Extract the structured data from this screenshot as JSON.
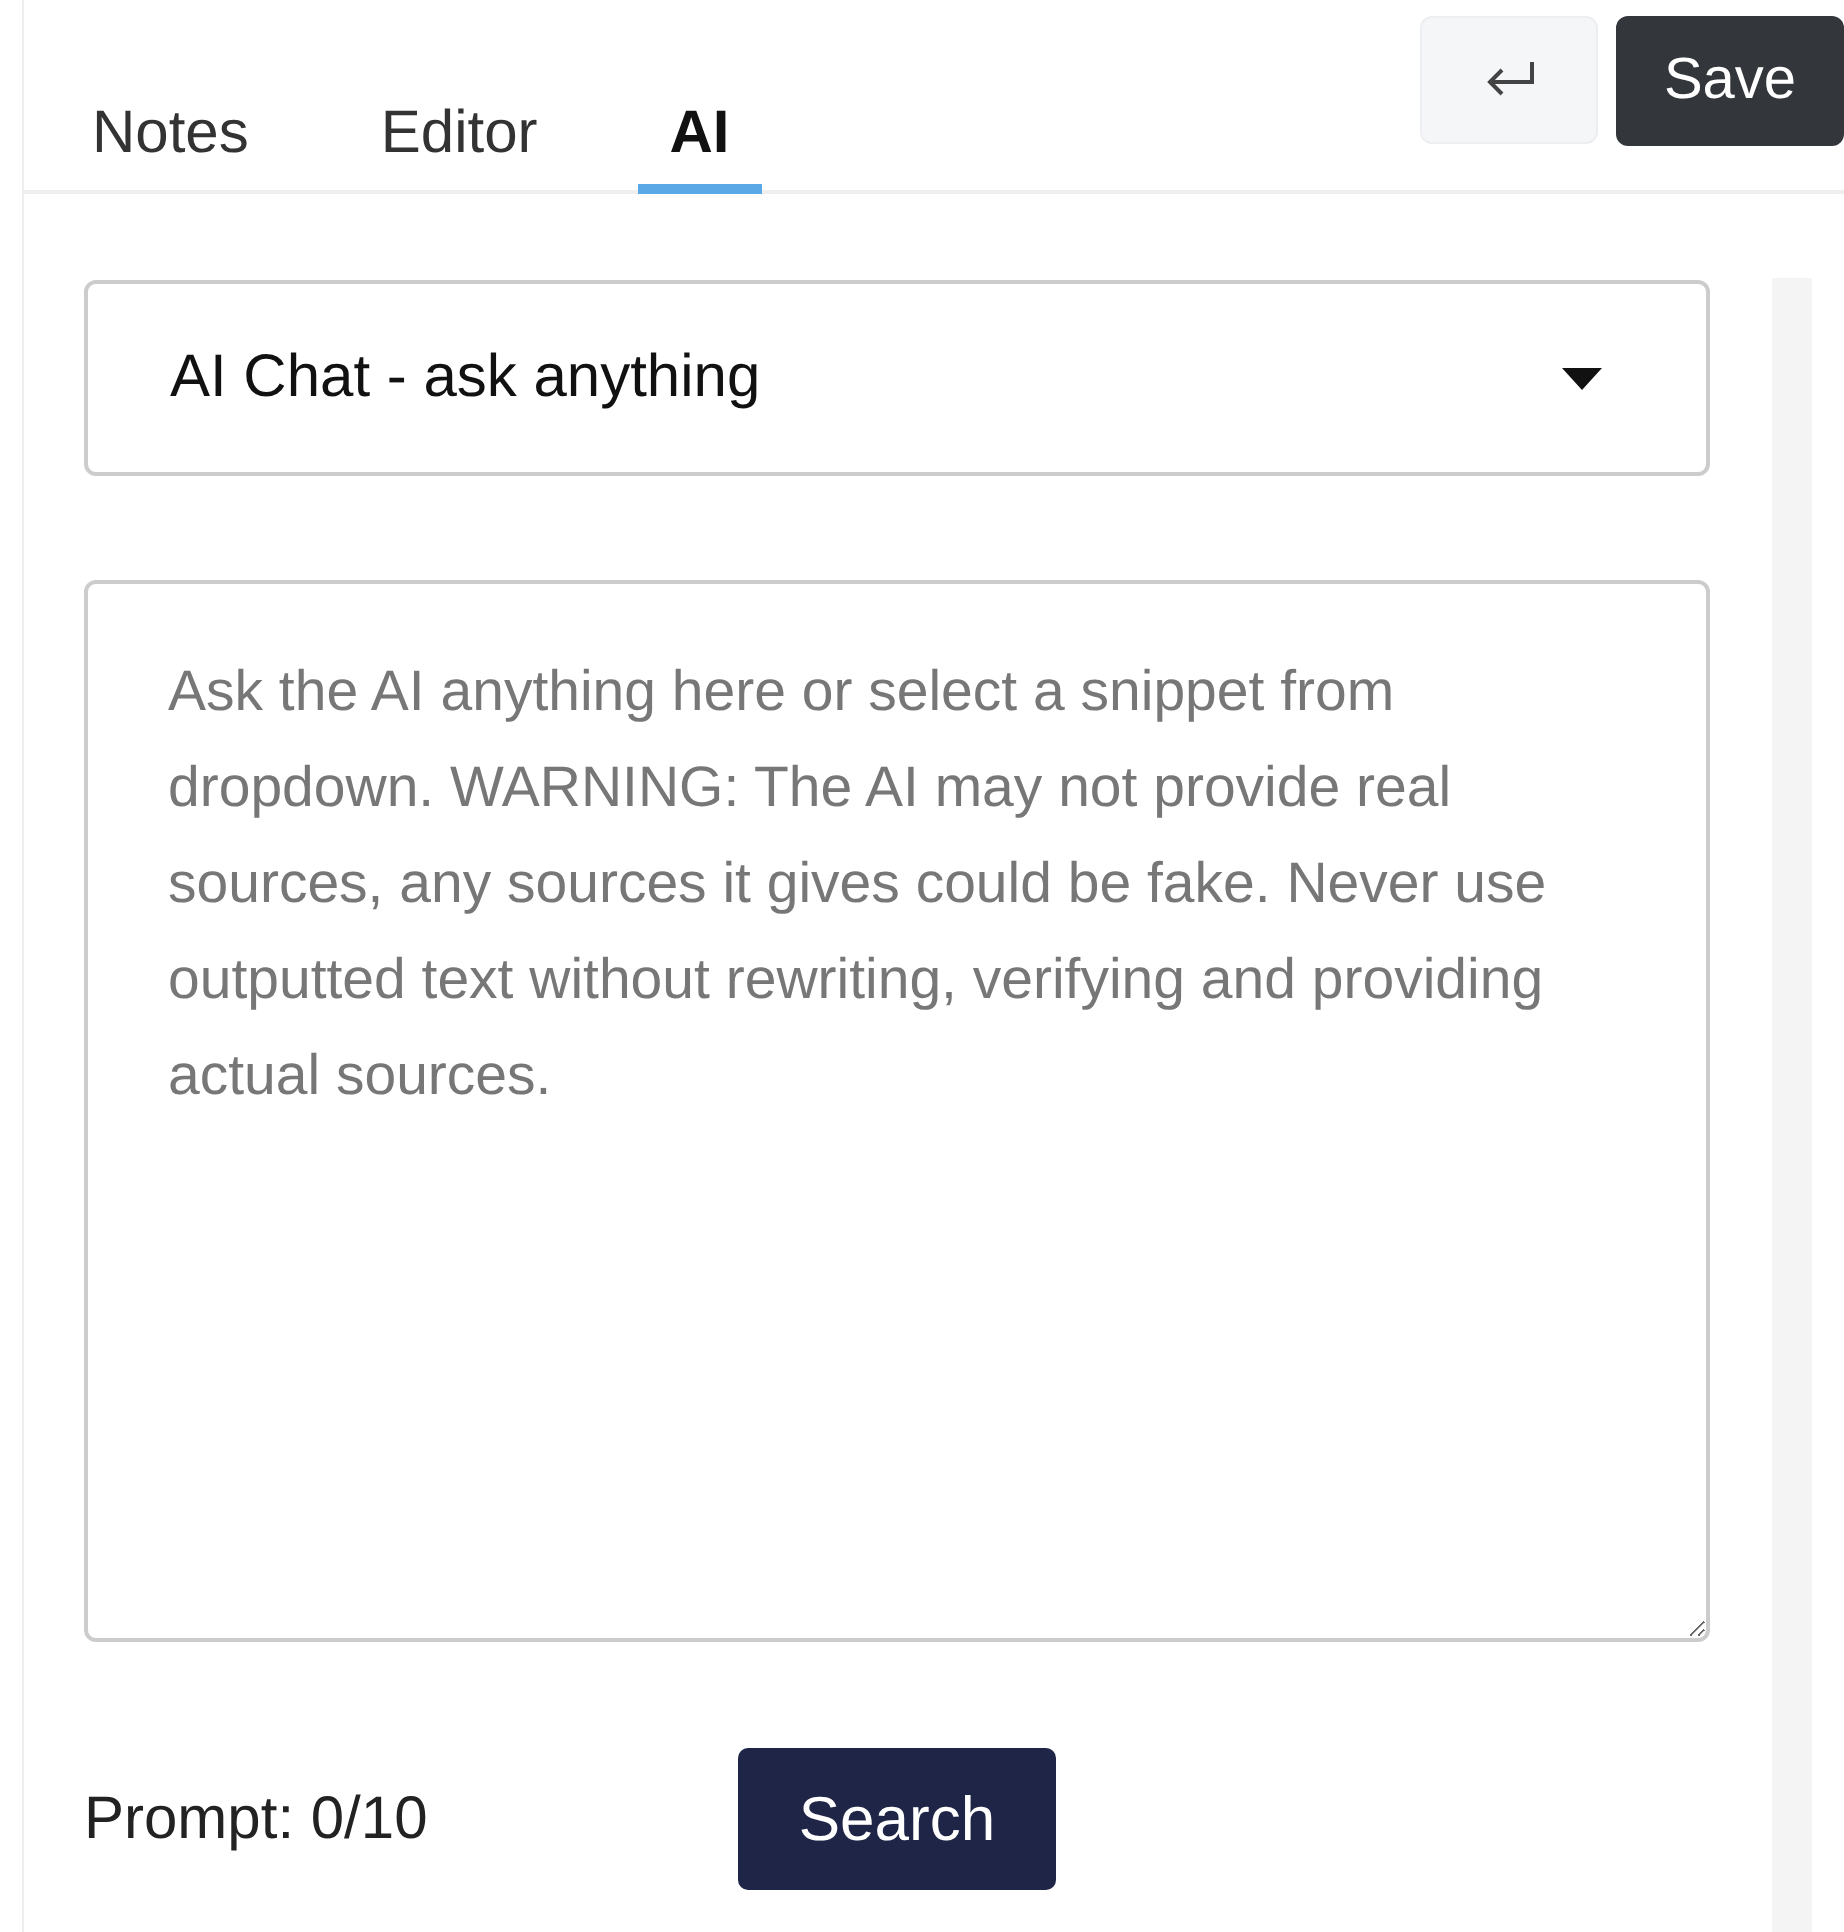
{
  "tabs": [
    {
      "label": "Notes",
      "selected": false
    },
    {
      "label": "Editor",
      "selected": false
    },
    {
      "label": "AI",
      "selected": true
    }
  ],
  "actions": {
    "save": "Save"
  },
  "mode_select": {
    "value": "AI Chat - ask anything"
  },
  "prompt_field": {
    "placeholder": "Ask the AI anything here or select a snippet from dropdown. WARNING: The AI may not provide real sources, any sources it gives could be fake. Never use outputted text without rewriting, verifying and providing actual sources."
  },
  "footer": {
    "prompt_count": "Prompt: 0/10",
    "search": "Search"
  }
}
